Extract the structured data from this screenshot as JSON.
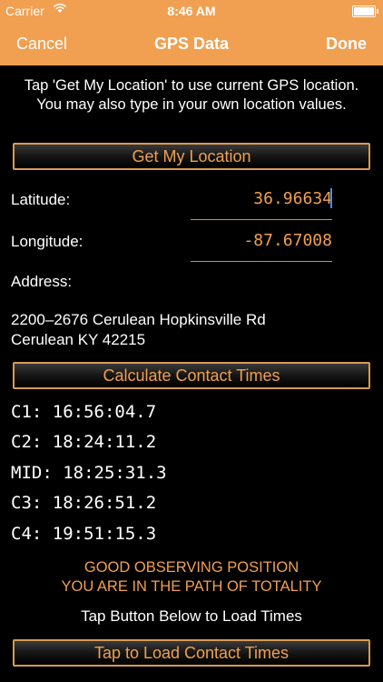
{
  "status_bar": {
    "carrier": "Carrier",
    "time": "8:46 AM"
  },
  "nav": {
    "cancel": "Cancel",
    "title": "GPS Data",
    "done": "Done"
  },
  "intro": "Tap 'Get My Location' to use current GPS location. You may also type in your own location values.",
  "buttons": {
    "get_location": "Get My Location",
    "calculate": "Calculate Contact Times",
    "load": "Tap to Load Contact Times"
  },
  "fields": {
    "latitude_label": "Latitude:",
    "latitude_value": "36.96634",
    "longitude_label": "Longitude:",
    "longitude_value": "-87.67008"
  },
  "address": {
    "label": "Address:",
    "line1": "2200–2676 Cerulean Hopkinsville Rd",
    "line2": "Cerulean KY 42215"
  },
  "contact_times": [
    "C1: 16:56:04.7",
    "C2: 18:24:11.2",
    "MID: 18:25:31.3",
    "C3: 18:26:51.2",
    "C4: 19:51:15.3"
  ],
  "status_message": {
    "line1": "GOOD OBSERVING POSITION",
    "line2": "YOU ARE IN THE PATH OF TOTALITY"
  },
  "instruction": "Tap Button Below to Load Times",
  "colors": {
    "accent": "#f0a050",
    "background": "#000000",
    "cursor": "#4a8ce8"
  },
  "icons": {
    "wifi": "wifi-icon",
    "battery": "battery-icon"
  }
}
